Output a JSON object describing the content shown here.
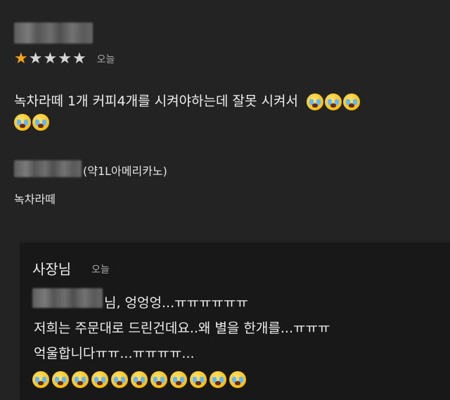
{
  "review": {
    "rating": 1,
    "max_rating": 5,
    "date_label": "오늘",
    "text": "녹차라떼 1개 커피4개를 시켜야하는데 잘못 시켜서",
    "inline_emoji_count": 3,
    "second_line_emoji_count": 2,
    "menu_note": "(약1L아메리카노)",
    "menu_item": "녹차라떼"
  },
  "owner_reply": {
    "name": "사장님",
    "date_label": "오늘",
    "line1": "님, 엉엉엉...ㅠㅠㅠㅠㅠㅠ",
    "line2": "저희는 주문대로 드린건데요..왜 별을 한개를...ㅠㅠㅠ",
    "line3": "억울합니다ㅠㅠ...ㅠㅠㅠㅠ...",
    "emoji_count": 11
  },
  "icons": {
    "star": "star-icon",
    "emoji": "loudly-crying-face-icon"
  },
  "colors": {
    "background": "#232323",
    "star_filled": "#f2a516",
    "star_empty": "#d7d7d7",
    "reply_background": "#181818"
  }
}
